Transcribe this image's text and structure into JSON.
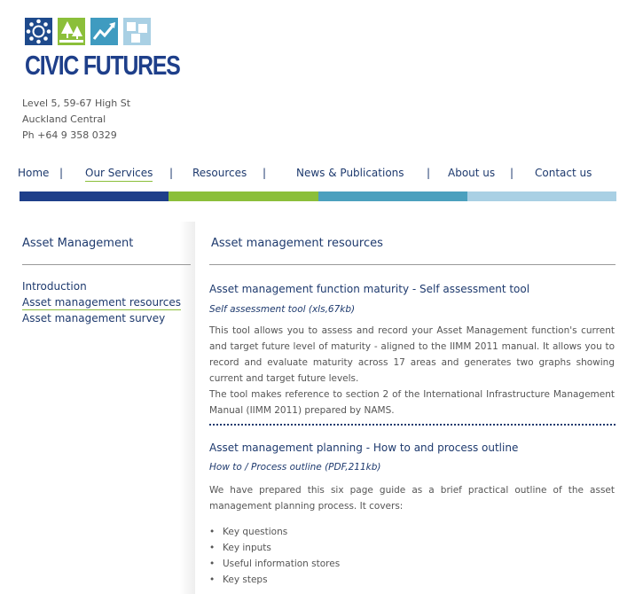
{
  "brand": {
    "name": "CIVIC FUTURES"
  },
  "address": {
    "line1": "Level 5, 59-67 High St",
    "line2": "Auckland Central",
    "phone": "Ph +64 9 358 0329"
  },
  "nav": {
    "items": [
      "Home",
      "Our Services",
      "Resources",
      "News & Publications",
      "About us",
      "Contact us"
    ],
    "separator": "|",
    "active": "Our Services"
  },
  "colors": {
    "navy": "#1e3f8a",
    "green": "#8bbf3a",
    "teal": "#4ba0be",
    "light_blue": "#a9d0e4"
  },
  "sidebar": {
    "title": "Asset Management",
    "links": [
      "Introduction",
      "Asset management resources",
      "Asset management survey"
    ],
    "active": "Asset management resources"
  },
  "main": {
    "title": "Asset management resources",
    "sections": [
      {
        "title": "Asset management function maturity - Self assessment tool",
        "file_link": "Self assessment tool (xls,67kb)",
        "paragraph1": "This tool allows you to assess and record your Asset Management function's current and target future level of maturity - aligned to the IIMM 2011 manual. It allows you to record and evaluate maturity across 17 areas and generates two graphs showing current and target future levels.",
        "paragraph2": "The tool makes reference to section 2 of the International Infrastructure Management Manual (IIMM 2011) prepared by NAMS."
      },
      {
        "title": "Asset management planning - How to and process outline",
        "file_link": "How to / Process outline (PDF,211kb)",
        "paragraph1": "We have prepared this six page guide as a brief practical outline of the asset management planning process. It covers:",
        "bullets": [
          "Key questions",
          "Key inputs",
          "Useful information stores",
          "Key steps"
        ]
      }
    ]
  }
}
